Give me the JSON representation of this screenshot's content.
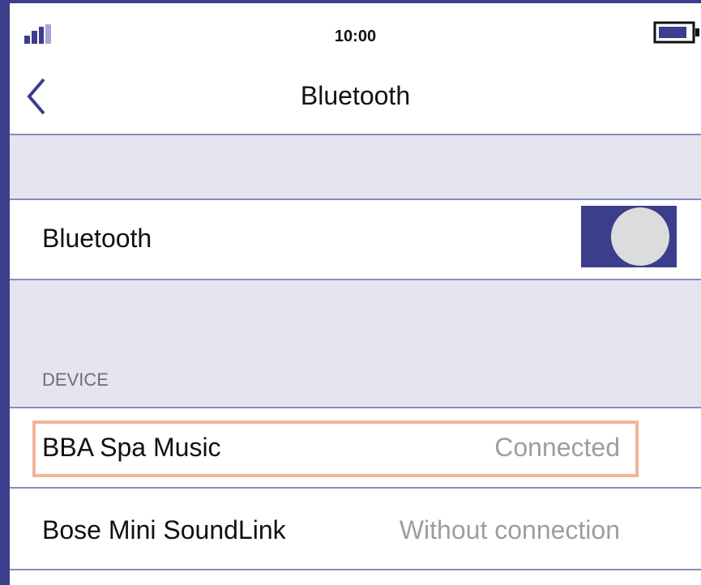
{
  "status_bar": {
    "time": "10:00",
    "signal_icon": "signal-strength-icon",
    "battery_icon": "battery-icon"
  },
  "nav": {
    "back_icon": "chevron-left-icon",
    "title": "Bluetooth"
  },
  "bluetooth_toggle": {
    "label": "Bluetooth",
    "state": "on"
  },
  "devices_section": {
    "header": "DEVICE",
    "items": [
      {
        "name": "BBA Spa Music",
        "status": "Connected",
        "highlighted": true
      },
      {
        "name": "Bose Mini SoundLink",
        "status": "Without connection",
        "highlighted": false
      }
    ]
  },
  "colors": {
    "accent": "#3c3d8c",
    "section_background": "#e4e5f1",
    "divider": "#8a8bc0",
    "highlight_border": "#f2b49a",
    "status_text": "#9e9e9e"
  }
}
